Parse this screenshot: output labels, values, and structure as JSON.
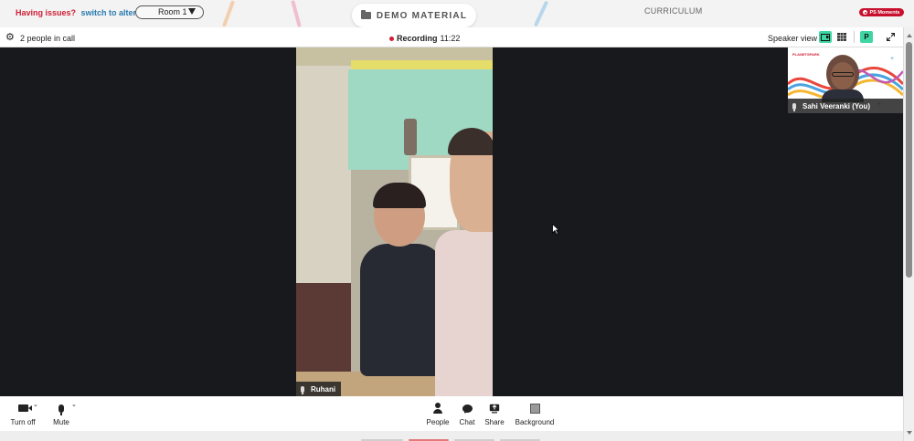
{
  "topbar": {
    "issues_text": "Having issues?",
    "switch_link": "switch to alternate room",
    "room_value": "Room 1",
    "demo_material": "DEMO MATERIAL",
    "curriculum": "CURRICULUM",
    "moments_badge": "PS Moments"
  },
  "callbar": {
    "people_count": "2 people in call",
    "recording_label": "Recording",
    "recording_time": "11:22",
    "view_mode": "Speaker view",
    "pin_label": "P"
  },
  "stage": {
    "main_participant": "Ruhani",
    "self_participant": "Sahi Veeranki (You)",
    "thumb_logo": "PLANETSPARK"
  },
  "controls": {
    "camera": "Turn off",
    "mic": "Mute",
    "people": "People",
    "chat": "Chat",
    "share": "Share",
    "background": "Background"
  },
  "colors": {
    "accent_green": "#3fd6a3",
    "alert_red": "#d11d35",
    "link_blue": "#2a7ab0",
    "stage_bg": "#17191d"
  }
}
